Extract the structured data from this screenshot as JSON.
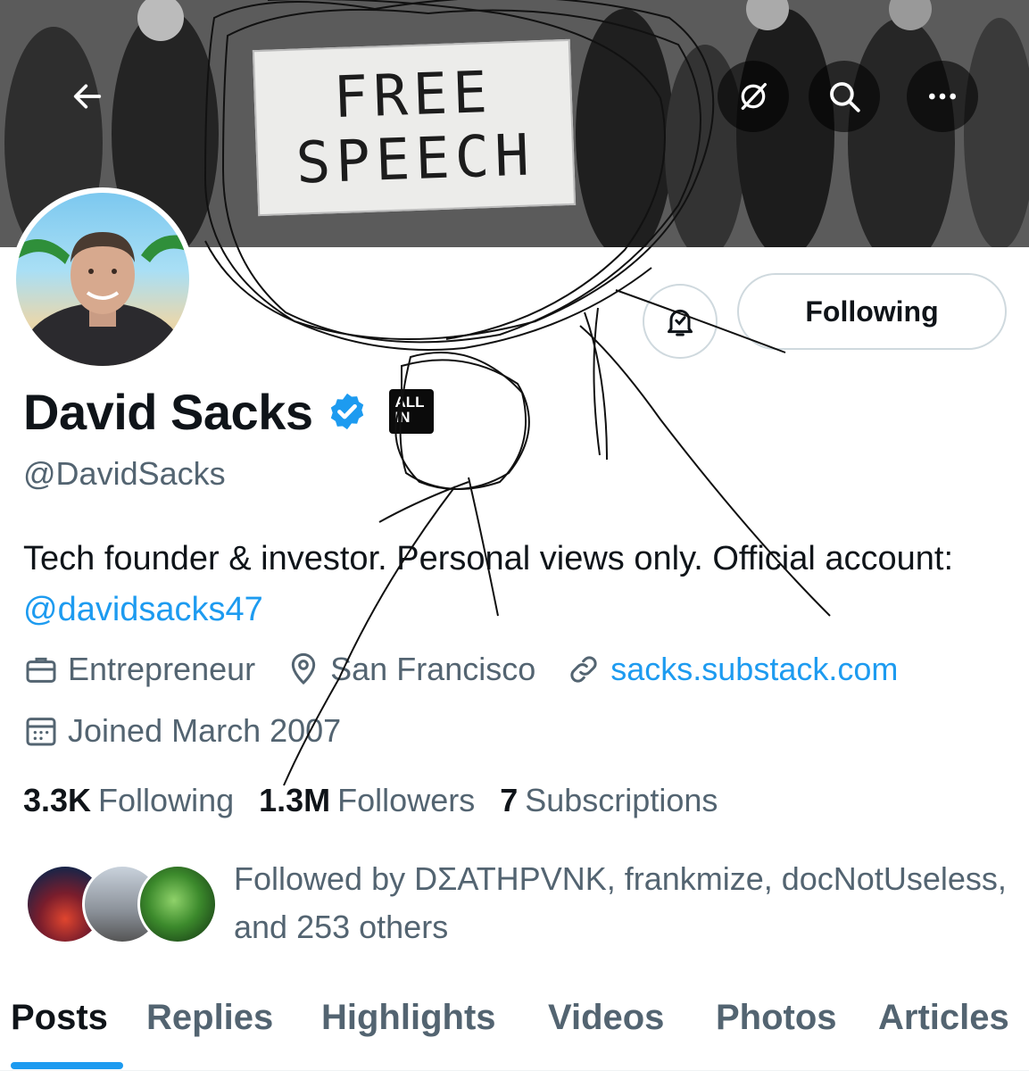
{
  "banner": {
    "sign_line1": "FREE",
    "sign_line2": "SPEECH"
  },
  "header": {
    "back_icon": "arrow-left-icon",
    "grok_icon": "grok-icon",
    "search_icon": "search-icon",
    "more_icon": "more-icon"
  },
  "profile": {
    "name": "David Sacks",
    "handle": "@DavidSacks",
    "verified_icon": "verified-badge-icon",
    "affiliation_badge": "ALL IN",
    "bio_text": "Tech founder & investor. Personal views only. Official account: ",
    "bio_mention": "@davidsacks47",
    "profession": "Entrepreneur",
    "location": "San Francisco",
    "website": "sacks.substack.com",
    "joined": "Joined March 2007",
    "following_count": "3.3K",
    "following_label": "Following",
    "followers_count": "1.3M",
    "followers_label": "Followers",
    "subscriptions_count": "7",
    "subscriptions_label": "Subscriptions",
    "followed_by": "Followed by DΣATHPVNK, frankmize, docNotUseless, and 253 others"
  },
  "actions": {
    "notifications_icon": "bell-icon",
    "follow_button": "Following"
  },
  "tabs": [
    "Posts",
    "Replies",
    "Highlights",
    "Videos",
    "Photos",
    "Articles"
  ],
  "active_tab": "Posts",
  "colors": {
    "accent": "#1d9bf0",
    "text_primary": "#0f1419",
    "text_secondary": "#536471"
  }
}
